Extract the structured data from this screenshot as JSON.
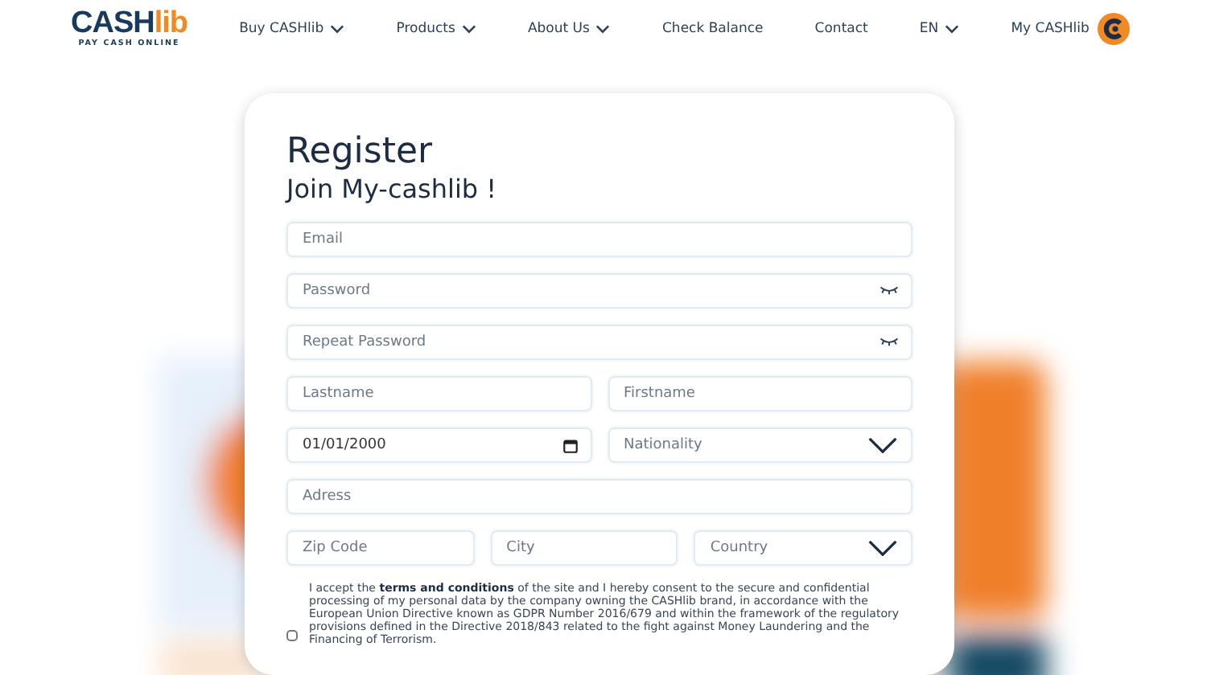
{
  "logo": {
    "brand_main": "CASH",
    "brand_accent": "lib",
    "tagline": "PAY CASH ONLINE"
  },
  "nav": [
    {
      "label": "Buy CASHlib",
      "dropdown": true
    },
    {
      "label": "Products",
      "dropdown": true
    },
    {
      "label": "About Us",
      "dropdown": true
    },
    {
      "label": "Check Balance",
      "dropdown": false
    },
    {
      "label": "Contact",
      "dropdown": false
    },
    {
      "label": "EN",
      "dropdown": true
    }
  ],
  "account": {
    "label": "My CASHlib"
  },
  "form": {
    "title": "Register",
    "subtitle": "Join My-cashlib !",
    "rows": [
      [
        {
          "kind": "text",
          "placeholder": "Email"
        }
      ],
      [
        {
          "kind": "password",
          "placeholder": "Password"
        }
      ],
      [
        {
          "kind": "password",
          "placeholder": "Repeat Password"
        }
      ],
      [
        {
          "kind": "text",
          "placeholder": "Lastname"
        },
        {
          "kind": "text",
          "placeholder": "Firstname"
        }
      ],
      [
        {
          "kind": "date",
          "value": "01/01/2000"
        },
        {
          "kind": "select",
          "placeholder": "Nationality"
        }
      ],
      [
        {
          "kind": "text",
          "placeholder": "Adress"
        }
      ],
      [
        {
          "kind": "text",
          "placeholder": "Zip Code"
        },
        {
          "kind": "text",
          "placeholder": "City"
        },
        {
          "kind": "select",
          "placeholder": "Country"
        }
      ]
    ],
    "consent": {
      "checked": false,
      "text": "I accept the **terms and conditions** of the site and I hereby consent to the secure and confidential processing of my personal data by the company owning the CASHlib brand, in accordance with the European Union Directive known as GDPR Number 2016/679 and within the framework of the regulatory provisions defined in the Directive 2018/843 related to the fight against Money Laundering and the Financing of Terrorism."
    }
  }
}
